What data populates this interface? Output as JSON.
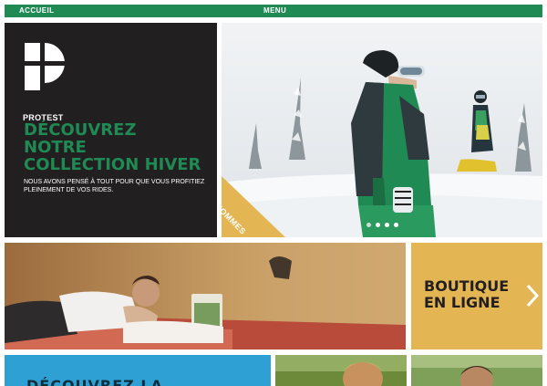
{
  "nav": {
    "home_label": "ACCUEIL",
    "menu_label": "MENU"
  },
  "promo": {
    "brand": "PROTEST",
    "headline_lines": [
      "DÉCOUVREZ",
      "NOTRE",
      "COLLECTION HIVER"
    ],
    "subtext": "NOUS AVONS PENSÉ À TOUT POUR QUE VOUS PROFITIEZ PLEINEMENT DE VOS RIDES."
  },
  "hero": {
    "tag_label": "HOMMES",
    "slide_count": 4,
    "active_slide": 0
  },
  "boutique": {
    "lines": [
      "BOUTIQUE",
      "EN LIGNE"
    ]
  },
  "bottom": {
    "blue_text": "DÉCOUVREZ LA"
  },
  "colors": {
    "nav_green": "#1f8a54",
    "promo_bg": "#221f20",
    "headline_green": "#1f8a54",
    "tag_yellow": "#e3b653",
    "boutique_yellow": "#e3b653",
    "bottom_blue": "#2fa0d4"
  },
  "icons": {
    "logo": "protest-logo-icon",
    "boutique_arrow": "chevron-right-icon"
  }
}
